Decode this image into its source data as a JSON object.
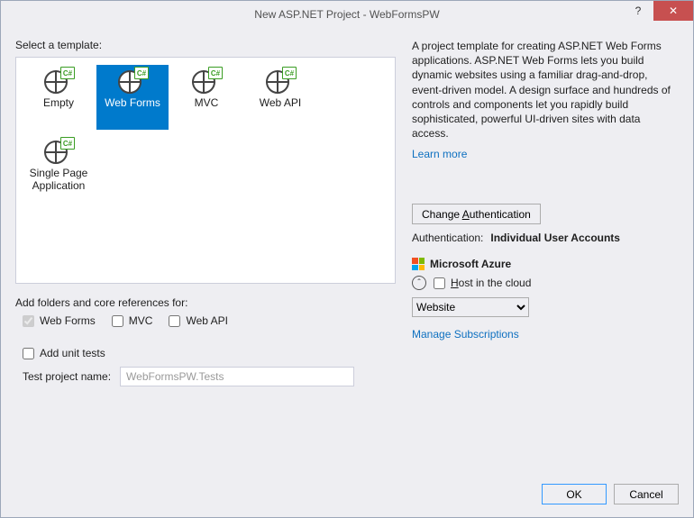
{
  "titlebar": {
    "title": "New ASP.NET Project - WebFormsPW",
    "help": "?",
    "close": "✕"
  },
  "left": {
    "select_template_label": "Select a template:",
    "templates": [
      {
        "label": "Empty"
      },
      {
        "label": "Web Forms"
      },
      {
        "label": "MVC"
      },
      {
        "label": "Web API"
      },
      {
        "label": "Single Page Application"
      }
    ],
    "folders_label": "Add folders and core references for:",
    "chk_webforms": "Web Forms",
    "chk_mvc": "MVC",
    "chk_webapi": "Web API",
    "chk_unit": "Add unit tests",
    "test_name_label": "Test project name:",
    "test_name_value": "WebFormsPW.Tests"
  },
  "right": {
    "description": "A project template for creating ASP.NET Web Forms applications. ASP.NET Web Forms lets you build dynamic websites using a familiar drag-and-drop, event-driven model. A design surface and hundreds of controls and components let you rapidly build sophisticated, powerful UI-driven sites with data access.",
    "learn_more": "Learn more",
    "change_auth": "Change Authentication",
    "auth_label": "Authentication:",
    "auth_value": "Individual User Accounts",
    "azure_heading": "Microsoft Azure",
    "host_label": "Host in the cloud",
    "resource_type": "Website",
    "manage_subscriptions": "Manage Subscriptions"
  },
  "footer": {
    "ok": "OK",
    "cancel": "Cancel"
  }
}
